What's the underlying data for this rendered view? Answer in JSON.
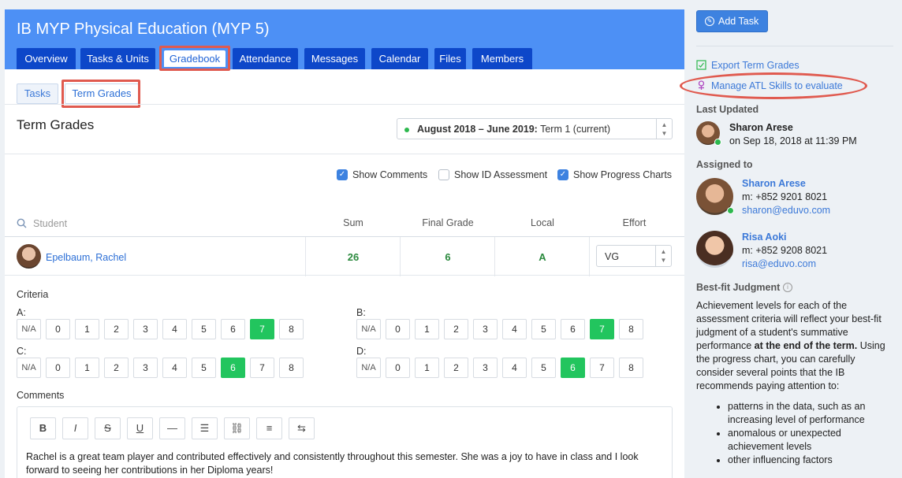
{
  "header": {
    "course_title": "IB MYP Physical Education (MYP 5)",
    "tabs": [
      {
        "label": "Overview"
      },
      {
        "label": "Tasks & Units"
      },
      {
        "label": "Gradebook"
      },
      {
        "label": "Attendance"
      },
      {
        "label": "Messages"
      },
      {
        "label": "Calendar"
      },
      {
        "label": "Files"
      },
      {
        "label": "Members"
      }
    ],
    "active_tab": "Gradebook"
  },
  "subtabs": [
    {
      "label": "Tasks"
    },
    {
      "label": "Term Grades"
    }
  ],
  "term_grades": {
    "title": "Term Grades",
    "term_range": "August 2018 – June 2019:",
    "term_name": "Term 1 (current)"
  },
  "options": {
    "show_comments": {
      "label": "Show Comments",
      "checked": true
    },
    "show_id_assessment": {
      "label": "Show ID Assessment",
      "checked": false
    },
    "show_progress_charts": {
      "label": "Show Progress Charts",
      "checked": true
    }
  },
  "table": {
    "student_placeholder": "Student",
    "columns": {
      "sum": "Sum",
      "final_grade": "Final Grade",
      "local": "Local",
      "effort": "Effort"
    },
    "row": {
      "student": "Epelbaum, Rachel",
      "sum": "26",
      "final_grade": "6",
      "local": "A",
      "effort": "VG"
    }
  },
  "criteria": {
    "label": "Criteria",
    "scale": [
      "N/A",
      "0",
      "1",
      "2",
      "3",
      "4",
      "5",
      "6",
      "7",
      "8"
    ],
    "items": [
      {
        "label": "A:",
        "selected": "7"
      },
      {
        "label": "B:",
        "selected": "7"
      },
      {
        "label": "C:",
        "selected": "6"
      },
      {
        "label": "D:",
        "selected": "6"
      }
    ]
  },
  "comments": {
    "label": "Comments",
    "toolbar": [
      "bold",
      "italic",
      "strikethrough",
      "underline",
      "horizontal-rule",
      "bullet-list",
      "link",
      "align",
      "swap"
    ],
    "toolbar_glyphs": [
      "B",
      "I",
      "S",
      "U",
      "—",
      "☰",
      "⛓",
      "≡",
      "⇆"
    ],
    "text": "Rachel is a great team player and contributed effectively and consistently throughout this semester. She was a joy to have in class and I look forward to seeing her contributions in her Diploma years!"
  },
  "sidebar": {
    "add_task": "Add Task",
    "export_term_grades": "Export Term Grades",
    "manage_atl": "Manage ATL Skills to evaluate",
    "last_updated_label": "Last Updated",
    "last_updated_name": "Sharon Arese",
    "last_updated_time": "on Sep 18, 2018 at 11:39 PM",
    "assigned_to_label": "Assigned to",
    "assignees": [
      {
        "name": "Sharon Arese",
        "phone": "m: +852 9201 8021",
        "email": "sharon@eduvo.com"
      },
      {
        "name": "Risa Aoki",
        "phone": "m: +852 9208 8021",
        "email": "risa@eduvo.com"
      }
    ],
    "best_fit_label": "Best-fit Judgment",
    "best_fit_text_1": "Achievement levels for each of the assessment criteria will reflect your best-fit judgment of a student's summative performance ",
    "best_fit_bold": "at the end of the term.",
    "best_fit_text_2": " Using the progress chart, you can carefully consider several points that the IB recommends paying attention to:",
    "best_fit_points": [
      "patterns in the data, such as an increasing level of performance",
      "anomalous or unexpected achievement levels",
      "other influencing factors"
    ]
  },
  "colors": {
    "header_bg": "#4d90f5",
    "tab_bg": "#0d47c9",
    "selected_grade": "#22c55e",
    "highlight": "#e05a4f",
    "link": "#3c79d8"
  }
}
